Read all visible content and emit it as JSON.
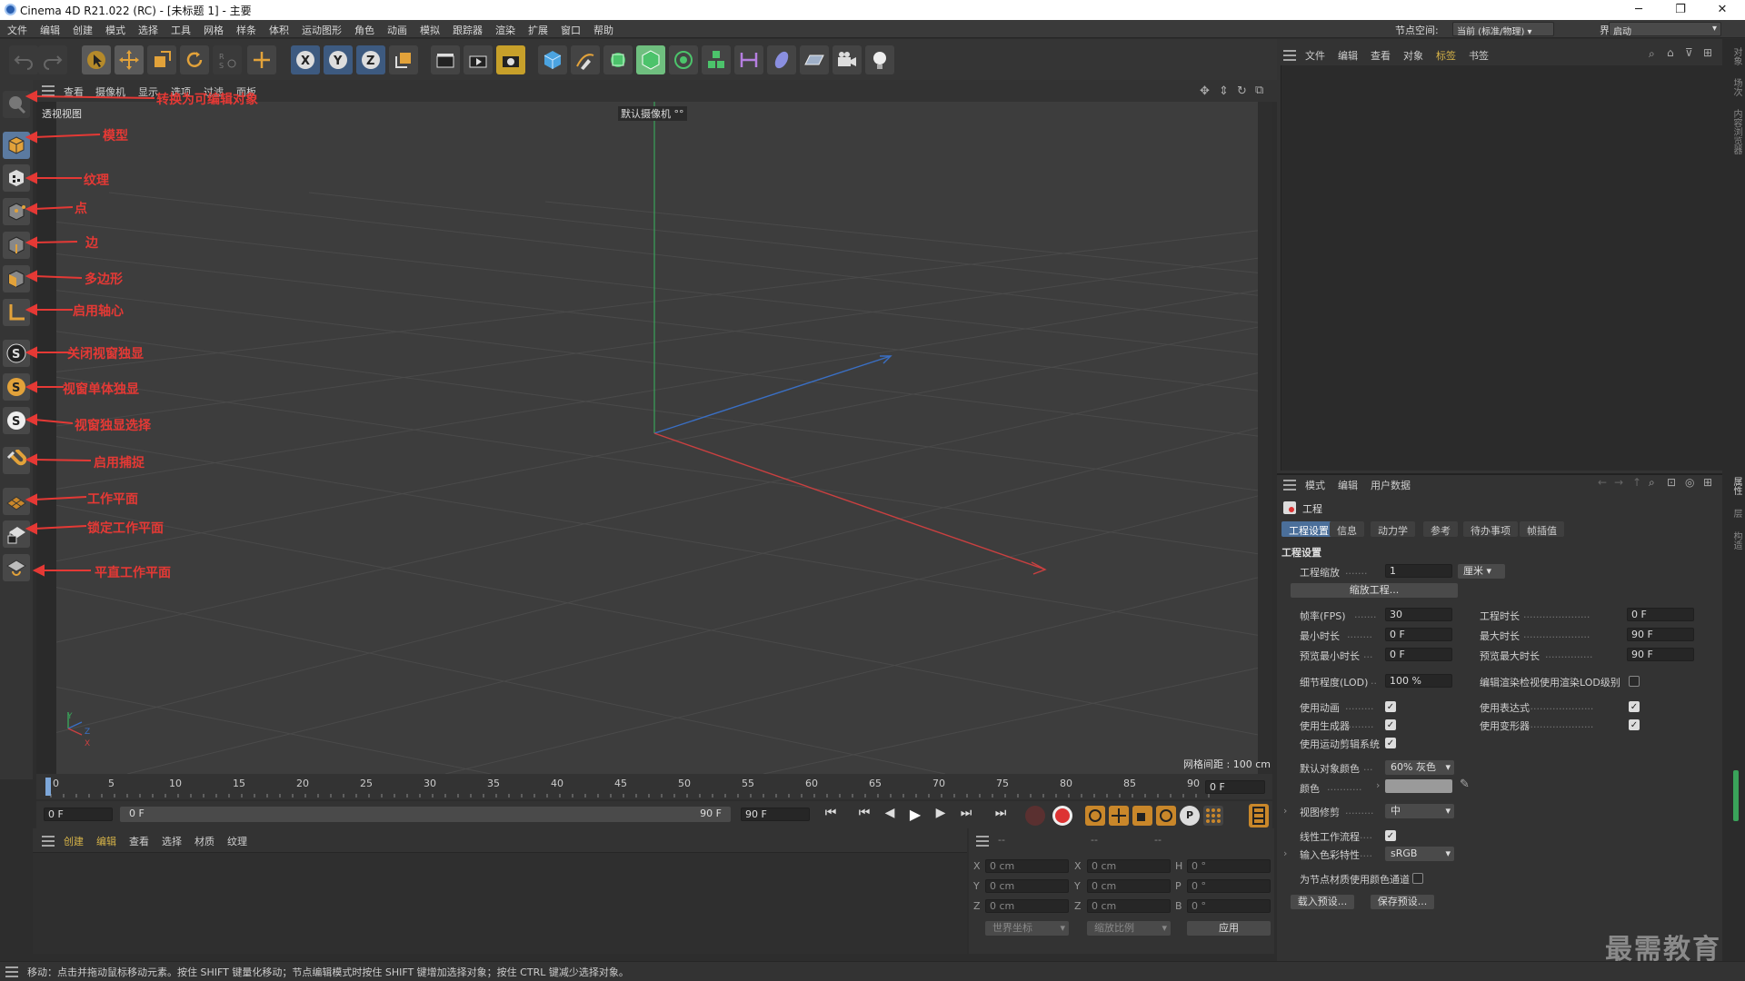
{
  "window": {
    "title": "Cinema 4D R21.022 (RC) - [未标题 1] - 主要",
    "min": "─",
    "max": "❐",
    "close": "✕"
  },
  "menu": [
    "文件",
    "编辑",
    "创建",
    "模式",
    "选择",
    "工具",
    "网格",
    "样条",
    "体积",
    "运动图形",
    "角色",
    "动画",
    "模拟",
    "跟踪器",
    "渲染",
    "扩展",
    "窗口",
    "帮助"
  ],
  "node_space": {
    "label": "节点空间:",
    "value": "当前 (标准/物理)"
  },
  "layout": {
    "label": "界面:",
    "value": "启动"
  },
  "viewport": {
    "menu": [
      "查看",
      "摄像机",
      "显示",
      "选项",
      "过滤",
      "面板"
    ],
    "name": "透视视图",
    "camera": "默认摄像机 °°",
    "grid": "网格间距 : 100 cm",
    "axis": {
      "y": "Y",
      "z": "Z",
      "x": "X"
    }
  },
  "annotations": [
    {
      "text": "转换为可编辑对象"
    },
    {
      "text": "模型"
    },
    {
      "text": "纹理"
    },
    {
      "text": "点"
    },
    {
      "text": "边"
    },
    {
      "text": "多边形"
    },
    {
      "text": "启用轴心"
    },
    {
      "text": "关闭视窗独显"
    },
    {
      "text": "视窗单体独显"
    },
    {
      "text": "视窗独显选择"
    },
    {
      "text": "启用捕捉"
    },
    {
      "text": "工作平面"
    },
    {
      "text": "锁定工作平面"
    },
    {
      "text": "平直工作平面"
    }
  ],
  "timeline": {
    "ticks": [
      "0",
      "5",
      "10",
      "15",
      "20",
      "25",
      "30",
      "35",
      "40",
      "45",
      "50",
      "55",
      "60",
      "65",
      "70",
      "75",
      "80",
      "85",
      "90"
    ],
    "current": "0 F",
    "start": "0 F",
    "range_start": "0 F",
    "range_end": "90 F",
    "end": "90 F"
  },
  "material": {
    "menu": [
      "创建",
      "编辑",
      "查看",
      "选择",
      "材质",
      "纹理"
    ]
  },
  "coords": {
    "headers": [
      "--",
      "--",
      "--"
    ],
    "rows": [
      {
        "a": "X",
        "av": "0 cm",
        "b": "X",
        "bv": "0 cm",
        "c": "H",
        "cv": "0 °"
      },
      {
        "a": "Y",
        "av": "0 cm",
        "b": "Y",
        "bv": "0 cm",
        "c": "P",
        "cv": "0 °"
      },
      {
        "a": "Z",
        "av": "0 cm",
        "b": "Z",
        "bv": "0 cm",
        "c": "B",
        "cv": "0 °"
      }
    ],
    "world": "世界坐标",
    "scale": "缩放比例",
    "apply": "应用"
  },
  "status": "移动：点击并拖动鼠标移动元素。按住 SHIFT 键量化移动；节点编辑模式时按住 SHIFT 键增加选择对象；按住 CTRL 键减少选择对象。",
  "objmgr": {
    "menu": [
      "文件",
      "编辑",
      "查看",
      "对象",
      "标签",
      "书签"
    ]
  },
  "attr": {
    "menu": [
      "模式",
      "编辑",
      "用户数据"
    ],
    "title": "工程",
    "tabs": [
      "工程设置",
      "信息",
      "动力学",
      "参考",
      "待办事项",
      "帧插值"
    ],
    "section": "工程设置",
    "scale_label": "工程缩放",
    "scale_value": "1",
    "scale_unit": "厘米",
    "scale_btn": "缩放工程...",
    "fps_label": "帧率(FPS)",
    "fps": "30",
    "time_label": "工程时长",
    "time": "0 F",
    "min_label": "最小时长",
    "min": "0 F",
    "max_label": "最大时长",
    "max": "90 F",
    "pmin_label": "预览最小时长",
    "pmin": "0 F",
    "pmax_label": "预览最大时长",
    "pmax": "90 F",
    "lod_label": "细节程度(LOD)",
    "lod": "100 %",
    "lod_render_label": "编辑渲染检视使用渲染LOD级别",
    "use_anim": "使用动画",
    "use_expr": "使用表达式",
    "use_gen": "使用生成器",
    "use_deform": "使用变形器",
    "use_motion": "使用运动剪辑系统",
    "def_color_label": "默认对象颜色",
    "def_color": "60% 灰色",
    "color_label": "颜色",
    "clip_label": "视图修剪",
    "clip": "中",
    "linear_label": "线性工作流程",
    "input_label": "输入色彩特性",
    "input": "sRGB",
    "node_mat_label": "为节点材质使用颜色通道",
    "load_preset": "载入预设...",
    "save_preset": "保存预设..."
  },
  "right_strip": [
    "对象",
    "场次",
    "内容浏览器",
    "属性",
    "层",
    "构造"
  ],
  "watermark": "最需教育",
  "colors": {
    "accent": "#4b6f9a",
    "annotation": "#e53935",
    "axis_x": "#c94040",
    "axis_y": "#3aa35a",
    "axis_z": "#3a6fc4",
    "highlight": "#c7a02a"
  }
}
